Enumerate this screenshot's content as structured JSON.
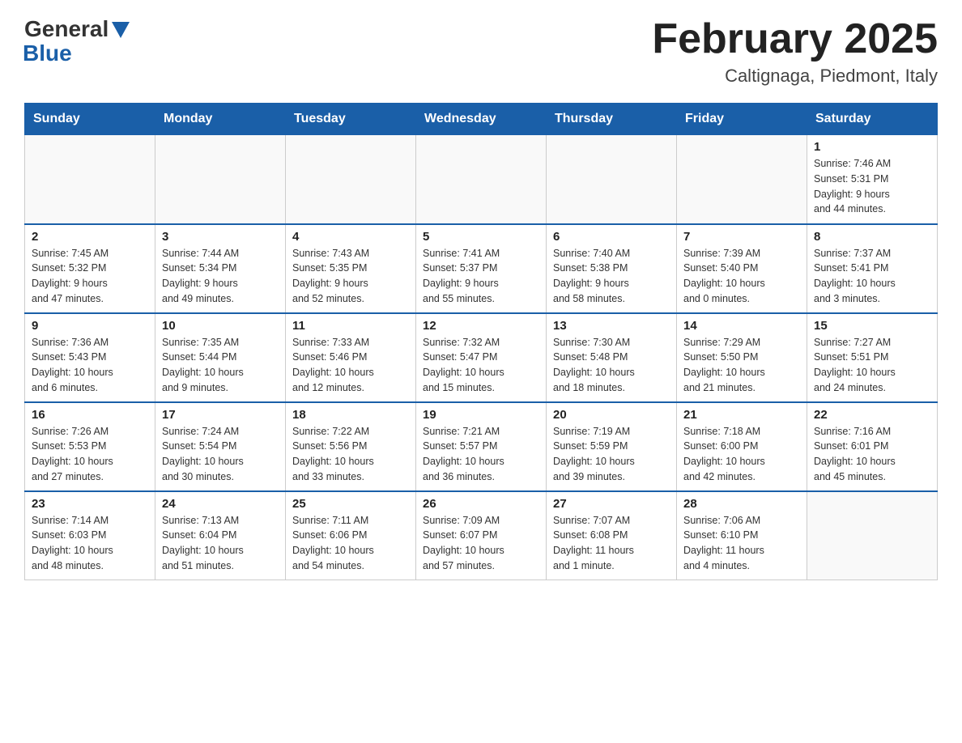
{
  "header": {
    "logo_general": "General",
    "logo_blue": "Blue",
    "month_title": "February 2025",
    "location": "Caltignaga, Piedmont, Italy"
  },
  "weekdays": [
    "Sunday",
    "Monday",
    "Tuesday",
    "Wednesday",
    "Thursday",
    "Friday",
    "Saturday"
  ],
  "weeks": [
    [
      {
        "day": "",
        "info": ""
      },
      {
        "day": "",
        "info": ""
      },
      {
        "day": "",
        "info": ""
      },
      {
        "day": "",
        "info": ""
      },
      {
        "day": "",
        "info": ""
      },
      {
        "day": "",
        "info": ""
      },
      {
        "day": "1",
        "info": "Sunrise: 7:46 AM\nSunset: 5:31 PM\nDaylight: 9 hours\nand 44 minutes."
      }
    ],
    [
      {
        "day": "2",
        "info": "Sunrise: 7:45 AM\nSunset: 5:32 PM\nDaylight: 9 hours\nand 47 minutes."
      },
      {
        "day": "3",
        "info": "Sunrise: 7:44 AM\nSunset: 5:34 PM\nDaylight: 9 hours\nand 49 minutes."
      },
      {
        "day": "4",
        "info": "Sunrise: 7:43 AM\nSunset: 5:35 PM\nDaylight: 9 hours\nand 52 minutes."
      },
      {
        "day": "5",
        "info": "Sunrise: 7:41 AM\nSunset: 5:37 PM\nDaylight: 9 hours\nand 55 minutes."
      },
      {
        "day": "6",
        "info": "Sunrise: 7:40 AM\nSunset: 5:38 PM\nDaylight: 9 hours\nand 58 minutes."
      },
      {
        "day": "7",
        "info": "Sunrise: 7:39 AM\nSunset: 5:40 PM\nDaylight: 10 hours\nand 0 minutes."
      },
      {
        "day": "8",
        "info": "Sunrise: 7:37 AM\nSunset: 5:41 PM\nDaylight: 10 hours\nand 3 minutes."
      }
    ],
    [
      {
        "day": "9",
        "info": "Sunrise: 7:36 AM\nSunset: 5:43 PM\nDaylight: 10 hours\nand 6 minutes."
      },
      {
        "day": "10",
        "info": "Sunrise: 7:35 AM\nSunset: 5:44 PM\nDaylight: 10 hours\nand 9 minutes."
      },
      {
        "day": "11",
        "info": "Sunrise: 7:33 AM\nSunset: 5:46 PM\nDaylight: 10 hours\nand 12 minutes."
      },
      {
        "day": "12",
        "info": "Sunrise: 7:32 AM\nSunset: 5:47 PM\nDaylight: 10 hours\nand 15 minutes."
      },
      {
        "day": "13",
        "info": "Sunrise: 7:30 AM\nSunset: 5:48 PM\nDaylight: 10 hours\nand 18 minutes."
      },
      {
        "day": "14",
        "info": "Sunrise: 7:29 AM\nSunset: 5:50 PM\nDaylight: 10 hours\nand 21 minutes."
      },
      {
        "day": "15",
        "info": "Sunrise: 7:27 AM\nSunset: 5:51 PM\nDaylight: 10 hours\nand 24 minutes."
      }
    ],
    [
      {
        "day": "16",
        "info": "Sunrise: 7:26 AM\nSunset: 5:53 PM\nDaylight: 10 hours\nand 27 minutes."
      },
      {
        "day": "17",
        "info": "Sunrise: 7:24 AM\nSunset: 5:54 PM\nDaylight: 10 hours\nand 30 minutes."
      },
      {
        "day": "18",
        "info": "Sunrise: 7:22 AM\nSunset: 5:56 PM\nDaylight: 10 hours\nand 33 minutes."
      },
      {
        "day": "19",
        "info": "Sunrise: 7:21 AM\nSunset: 5:57 PM\nDaylight: 10 hours\nand 36 minutes."
      },
      {
        "day": "20",
        "info": "Sunrise: 7:19 AM\nSunset: 5:59 PM\nDaylight: 10 hours\nand 39 minutes."
      },
      {
        "day": "21",
        "info": "Sunrise: 7:18 AM\nSunset: 6:00 PM\nDaylight: 10 hours\nand 42 minutes."
      },
      {
        "day": "22",
        "info": "Sunrise: 7:16 AM\nSunset: 6:01 PM\nDaylight: 10 hours\nand 45 minutes."
      }
    ],
    [
      {
        "day": "23",
        "info": "Sunrise: 7:14 AM\nSunset: 6:03 PM\nDaylight: 10 hours\nand 48 minutes."
      },
      {
        "day": "24",
        "info": "Sunrise: 7:13 AM\nSunset: 6:04 PM\nDaylight: 10 hours\nand 51 minutes."
      },
      {
        "day": "25",
        "info": "Sunrise: 7:11 AM\nSunset: 6:06 PM\nDaylight: 10 hours\nand 54 minutes."
      },
      {
        "day": "26",
        "info": "Sunrise: 7:09 AM\nSunset: 6:07 PM\nDaylight: 10 hours\nand 57 minutes."
      },
      {
        "day": "27",
        "info": "Sunrise: 7:07 AM\nSunset: 6:08 PM\nDaylight: 11 hours\nand 1 minute."
      },
      {
        "day": "28",
        "info": "Sunrise: 7:06 AM\nSunset: 6:10 PM\nDaylight: 11 hours\nand 4 minutes."
      },
      {
        "day": "",
        "info": ""
      }
    ]
  ]
}
